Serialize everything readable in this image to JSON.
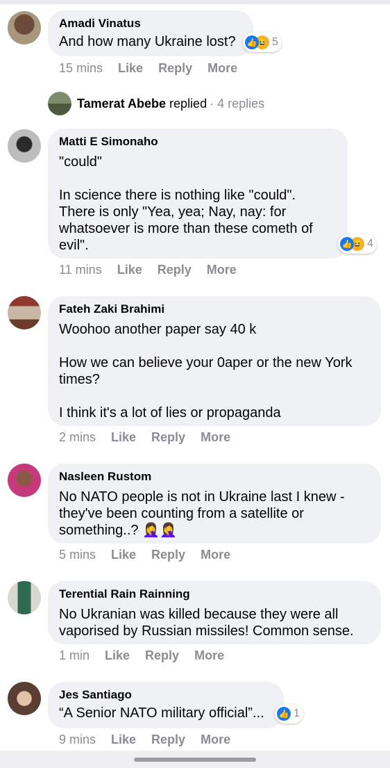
{
  "comments": [
    {
      "name": "Amadi Vinatus",
      "text": "And how many Ukraine lost?",
      "time": "15 mins",
      "reactions": "5"
    },
    {
      "name": "Matti E Simonaho",
      "text": "\"could\"\n\nIn science there is nothing like \"could\".\nThere is only \"Yea, yea; Nay, nay: for\nwhatsoever is more than these cometh of\nevil\".",
      "time": "11 mins",
      "reactions": "4"
    },
    {
      "name": "Fateh Zaki Brahimi",
      "text": "Woohoo another paper say 40 k\n\nHow we can believe your 0aper or the new York\ntimes?\n\nI think it's a lot of lies or propaganda",
      "time": "2 mins"
    },
    {
      "name": "Nasleen Rustom",
      "text": "No NATO people is not in Ukraine last I knew -\nthey've been counting from a satellite or\nsomething..? 🤦‍♀️🤦‍♀️",
      "time": "5 mins"
    },
    {
      "name": "Terential Rain Rainning",
      "text": "No Ukranian was killed because they were all\nvaporised by Russian missiles! Common sense.",
      "time": "1 min"
    },
    {
      "name": "Jes Santiago",
      "text": "“A Senior NATO military official”...",
      "time": "9 mins",
      "reactions": "1"
    }
  ],
  "reply_summary": {
    "name": "Tamerat Abebe",
    "word": "replied",
    "count": "· 4 replies"
  },
  "actions": {
    "like": "Like",
    "reply": "Reply",
    "more": "More"
  },
  "icons": {
    "like": "like-icon",
    "haha": "haha-icon"
  },
  "colors": {
    "bubble": "#eff1f4",
    "meta": "#8a8d91",
    "like_blue": "#1877f2",
    "haha_yellow": "#f7b125"
  }
}
